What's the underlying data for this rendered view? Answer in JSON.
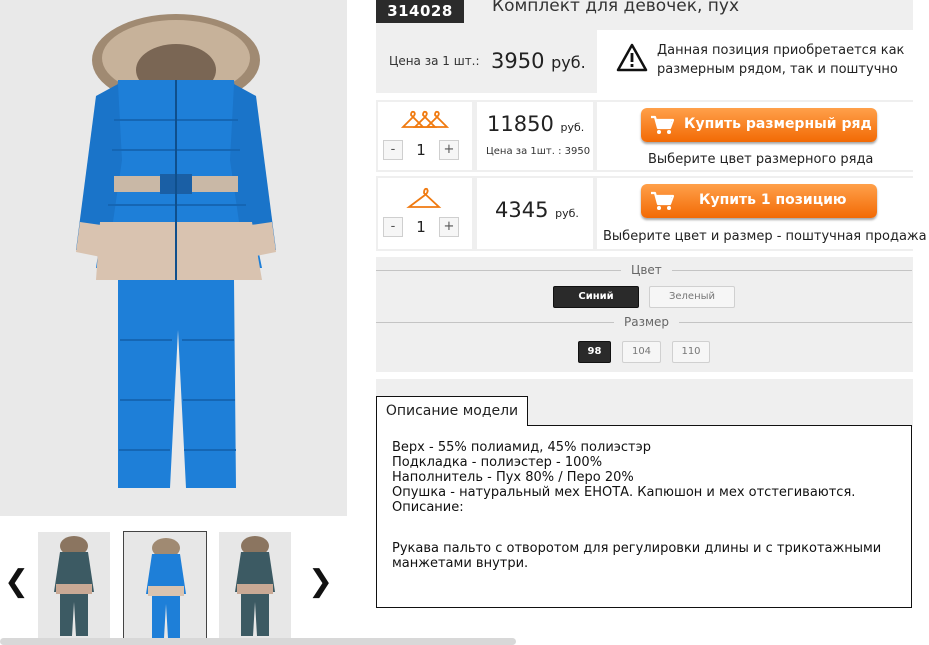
{
  "product": {
    "sku": "314028",
    "title": "Комплект для девочек, пух"
  },
  "price": {
    "label": "Цена за 1 шт.:",
    "value": "3950",
    "unit": "руб."
  },
  "notice": {
    "icon": "warning-icon",
    "text": "Данная позиция приобретается как размерным рядом, так и поштучно"
  },
  "set_purchase": {
    "icon": "hangers-group-icon",
    "qty": "1",
    "minus": "-",
    "plus": "+",
    "price": "11850",
    "unit": "руб.",
    "per_unit": "Цена за 1шт. : 3950",
    "button": "Купить размерный ряд",
    "hint": "Выберите цвет размерного ряда"
  },
  "single_purchase": {
    "icon": "hanger-icon",
    "qty": "1",
    "minus": "-",
    "plus": "+",
    "price": "4345",
    "unit": "руб.",
    "button": "Купить 1 позицию",
    "hint": "Выберите цвет и размер - поштучная продажа"
  },
  "options": {
    "color_label": "Цвет",
    "colors": [
      {
        "label": "Синий",
        "selected": true
      },
      {
        "label": "Зеленый",
        "selected": false
      }
    ],
    "size_label": "Размер",
    "sizes": [
      {
        "label": "98",
        "selected": true
      },
      {
        "label": "104",
        "selected": false
      },
      {
        "label": "110",
        "selected": false
      }
    ]
  },
  "description": {
    "tab": "Описание модели",
    "lines": [
      "Верх -  55% полиамид, 45% полиэстэр",
      "Подкладка - полиэстер - 100%",
      "Наполнитель - Пух 80% / Перо 20%",
      "Опушка - натуральный мех ЕНОТА. Капюшон и мех отстегиваются.",
      "Описание:"
    ],
    "paragraph": "Рукава пальто с отворотом для регулировки длины и с трикотажными манжетами внутри."
  },
  "gallery": {
    "prev": "❮",
    "next": "❯",
    "thumbnails": [
      "thumbnail-dark-jacket",
      "thumbnail-blue-jacket",
      "thumbnail-dark-jacket-2"
    ],
    "active_index": 1
  },
  "colors": {
    "accent_orange": "#f26a05",
    "sku_bg": "#2b2b2b",
    "panel_bg": "#efefef",
    "jacket_blue": "#1e7fd8",
    "jacket_beige": "#d9c3b0"
  }
}
